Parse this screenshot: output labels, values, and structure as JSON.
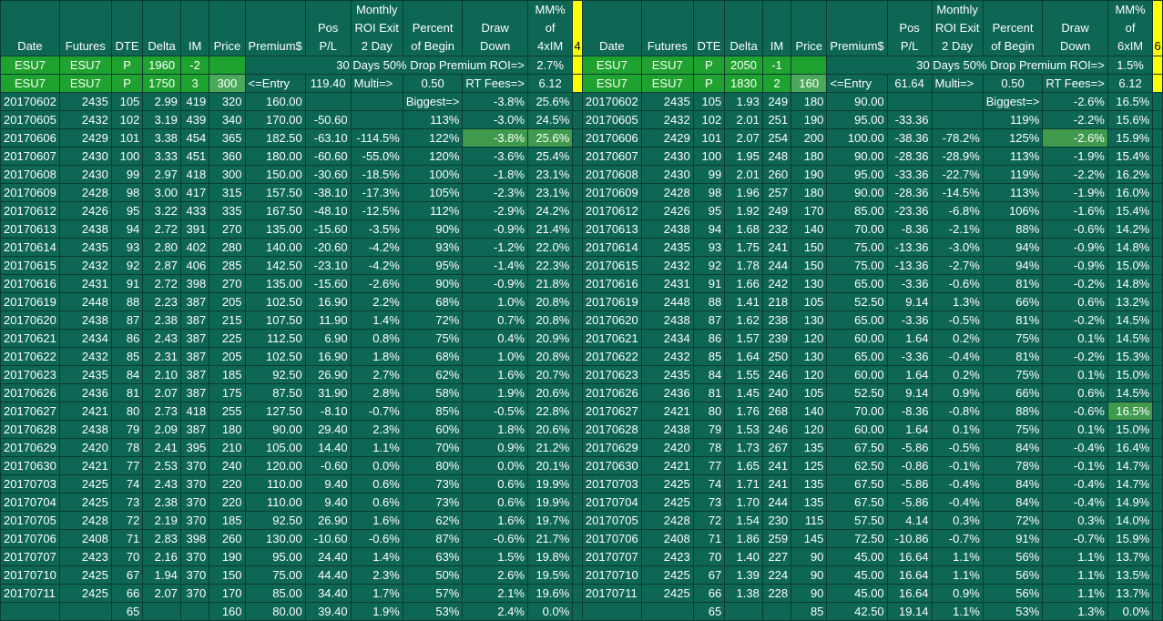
{
  "colors": {
    "background": "#0e6655",
    "header_green": "#1fa22f",
    "highlight_green": "#3f9a4e",
    "marker_yellow": "#ffff00"
  },
  "left": {
    "headers": [
      "Date",
      "Futures",
      "DTE",
      "Delta",
      "IM",
      "Price",
      "Premium$",
      "Pos P/L",
      "Monthly ROI Exit 2 Day",
      "Percent of Begin",
      "Draw Down",
      "MM% of 4xIM"
    ],
    "marker": "4",
    "setup1": {
      "date": "ESU7",
      "futures": "ESU7",
      "dte": "P",
      "delta": "1960",
      "im": "-2",
      "summary": "30 Days 50% Drop Premium ROI=>",
      "mm": "2.7%"
    },
    "setup2": {
      "date": "ESU7",
      "futures": "ESU7",
      "dte": "P",
      "delta": "1750",
      "im": "3",
      "price": "300",
      "premium": "<=Entry",
      "pospl": "119.40",
      "roi": "Multi=>",
      "pct": "0.50",
      "draw": "RT Fees=>",
      "mm": "6.12"
    },
    "rows": [
      [
        "20170602",
        "2435",
        "105",
        "2.99",
        "419",
        "320",
        "160.00",
        "",
        "",
        "Biggest=>",
        "-3.8%",
        "25.6%"
      ],
      [
        "20170605",
        "2432",
        "102",
        "3.19",
        "439",
        "340",
        "170.00",
        "-50.60",
        "",
        "113%",
        "-3.0%",
        "24.5%"
      ],
      [
        "20170606",
        "2429",
        "101",
        "3.38",
        "454",
        "365",
        "182.50",
        "-63.10",
        "-114.5%",
        "122%",
        "-3.8%",
        "25.6%"
      ],
      [
        "20170607",
        "2430",
        "100",
        "3.33",
        "451",
        "360",
        "180.00",
        "-60.60",
        "-55.0%",
        "120%",
        "-3.6%",
        "25.4%"
      ],
      [
        "20170608",
        "2430",
        "99",
        "2.97",
        "418",
        "300",
        "150.00",
        "-30.60",
        "-18.5%",
        "100%",
        "-1.8%",
        "23.1%"
      ],
      [
        "20170609",
        "2428",
        "98",
        "3.00",
        "417",
        "315",
        "157.50",
        "-38.10",
        "-17.3%",
        "105%",
        "-2.3%",
        "23.1%"
      ],
      [
        "20170612",
        "2426",
        "95",
        "3.22",
        "433",
        "335",
        "167.50",
        "-48.10",
        "-12.5%",
        "112%",
        "-2.9%",
        "24.2%"
      ],
      [
        "20170613",
        "2438",
        "94",
        "2.72",
        "391",
        "270",
        "135.00",
        "-15.60",
        "-3.5%",
        "90%",
        "-0.9%",
        "21.4%"
      ],
      [
        "20170614",
        "2435",
        "93",
        "2.80",
        "402",
        "280",
        "140.00",
        "-20.60",
        "-4.2%",
        "93%",
        "-1.2%",
        "22.0%"
      ],
      [
        "20170615",
        "2432",
        "92",
        "2.87",
        "406",
        "285",
        "142.50",
        "-23.10",
        "-4.2%",
        "95%",
        "-1.4%",
        "22.3%"
      ],
      [
        "20170616",
        "2431",
        "91",
        "2.72",
        "398",
        "270",
        "135.00",
        "-15.60",
        "-2.6%",
        "90%",
        "-0.9%",
        "21.8%"
      ],
      [
        "20170619",
        "2448",
        "88",
        "2.23",
        "387",
        "205",
        "102.50",
        "16.90",
        "2.2%",
        "68%",
        "1.0%",
        "20.8%"
      ],
      [
        "20170620",
        "2438",
        "87",
        "2.38",
        "387",
        "215",
        "107.50",
        "11.90",
        "1.4%",
        "72%",
        "0.7%",
        "20.8%"
      ],
      [
        "20170621",
        "2434",
        "86",
        "2.43",
        "387",
        "225",
        "112.50",
        "6.90",
        "0.8%",
        "75%",
        "0.4%",
        "20.9%"
      ],
      [
        "20170622",
        "2432",
        "85",
        "2.31",
        "387",
        "205",
        "102.50",
        "16.90",
        "1.8%",
        "68%",
        "1.0%",
        "20.8%"
      ],
      [
        "20170623",
        "2435",
        "84",
        "2.10",
        "387",
        "185",
        "92.50",
        "26.90",
        "2.7%",
        "62%",
        "1.6%",
        "20.7%"
      ],
      [
        "20170626",
        "2436",
        "81",
        "2.07",
        "387",
        "175",
        "87.50",
        "31.90",
        "2.8%",
        "58%",
        "1.9%",
        "20.6%"
      ],
      [
        "20170627",
        "2421",
        "80",
        "2.73",
        "418",
        "255",
        "127.50",
        "-8.10",
        "-0.7%",
        "85%",
        "-0.5%",
        "22.8%"
      ],
      [
        "20170628",
        "2438",
        "79",
        "2.09",
        "387",
        "180",
        "90.00",
        "29.40",
        "2.3%",
        "60%",
        "1.8%",
        "20.6%"
      ],
      [
        "20170629",
        "2420",
        "78",
        "2.41",
        "395",
        "210",
        "105.00",
        "14.40",
        "1.1%",
        "70%",
        "0.9%",
        "21.2%"
      ],
      [
        "20170630",
        "2421",
        "77",
        "2.53",
        "370",
        "240",
        "120.00",
        "-0.60",
        "0.0%",
        "80%",
        "0.0%",
        "20.1%"
      ],
      [
        "20170703",
        "2425",
        "74",
        "2.43",
        "370",
        "220",
        "110.00",
        "9.40",
        "0.6%",
        "73%",
        "0.6%",
        "19.9%"
      ],
      [
        "20170704",
        "2425",
        "73",
        "2.38",
        "370",
        "220",
        "110.00",
        "9.40",
        "0.6%",
        "73%",
        "0.6%",
        "19.9%"
      ],
      [
        "20170705",
        "2428",
        "72",
        "2.19",
        "370",
        "185",
        "92.50",
        "26.90",
        "1.6%",
        "62%",
        "1.6%",
        "19.7%"
      ],
      [
        "20170706",
        "2408",
        "71",
        "2.83",
        "398",
        "260",
        "130.00",
        "-10.60",
        "-0.6%",
        "87%",
        "-0.6%",
        "21.7%"
      ],
      [
        "20170707",
        "2423",
        "70",
        "2.16",
        "370",
        "190",
        "95.00",
        "24.40",
        "1.4%",
        "63%",
        "1.5%",
        "19.8%"
      ],
      [
        "20170710",
        "2425",
        "67",
        "1.94",
        "370",
        "150",
        "75.00",
        "44.40",
        "2.3%",
        "50%",
        "2.6%",
        "19.5%"
      ],
      [
        "20170711",
        "2425",
        "66",
        "2.07",
        "370",
        "170",
        "85.00",
        "34.40",
        "1.7%",
        "57%",
        "2.1%",
        "19.6%"
      ]
    ],
    "totals": [
      "",
      "",
      "65",
      "",
      "",
      "160",
      "80.00",
      "39.40",
      "1.9%",
      "53%",
      "2.4%",
      "0.0%"
    ]
  },
  "right": {
    "headers": [
      "Date",
      "Futures",
      "DTE",
      "Delta",
      "IM",
      "Price",
      "Premium$",
      "Pos P/L",
      "Monthly ROI Exit 2 Day",
      "Percent of Begin",
      "Draw Down",
      "MM% of 6xIM"
    ],
    "marker": "6",
    "setup1": {
      "date": "ESU7",
      "futures": "ESU7",
      "dte": "P",
      "delta": "2050",
      "im": "-1",
      "summary": "30 Days 50% Drop Premium ROI=>",
      "mm": "1.5%"
    },
    "setup2": {
      "date": "ESU7",
      "futures": "ESU7",
      "dte": "P",
      "delta": "1830",
      "im": "2",
      "price": "160",
      "premium": "<=Entry",
      "pospl": "61.64",
      "roi": "Multi=>",
      "pct": "0.50",
      "draw": "RT Fees=>",
      "mm": "6.12"
    },
    "rows": [
      [
        "20170602",
        "2435",
        "105",
        "1.93",
        "249",
        "180",
        "90.00",
        "",
        "",
        "Biggest=>",
        "-2.6%",
        "16.5%"
      ],
      [
        "20170605",
        "2432",
        "102",
        "2.01",
        "251",
        "190",
        "95.00",
        "-33.36",
        "",
        "119%",
        "-2.2%",
        "15.6%"
      ],
      [
        "20170606",
        "2429",
        "101",
        "2.07",
        "254",
        "200",
        "100.00",
        "-38.36",
        "-78.2%",
        "125%",
        "-2.6%",
        "15.9%"
      ],
      [
        "20170607",
        "2430",
        "100",
        "1.95",
        "248",
        "180",
        "90.00",
        "-28.36",
        "-28.9%",
        "113%",
        "-1.9%",
        "15.4%"
      ],
      [
        "20170608",
        "2430",
        "99",
        "2.01",
        "260",
        "190",
        "95.00",
        "-33.36",
        "-22.7%",
        "119%",
        "-2.2%",
        "16.2%"
      ],
      [
        "20170609",
        "2428",
        "98",
        "1.96",
        "257",
        "180",
        "90.00",
        "-28.36",
        "-14.5%",
        "113%",
        "-1.9%",
        "16.0%"
      ],
      [
        "20170612",
        "2426",
        "95",
        "1.92",
        "249",
        "170",
        "85.00",
        "-23.36",
        "-6.8%",
        "106%",
        "-1.6%",
        "15.4%"
      ],
      [
        "20170613",
        "2438",
        "94",
        "1.68",
        "232",
        "140",
        "70.00",
        "-8.36",
        "-2.1%",
        "88%",
        "-0.6%",
        "14.2%"
      ],
      [
        "20170614",
        "2435",
        "93",
        "1.75",
        "241",
        "150",
        "75.00",
        "-13.36",
        "-3.0%",
        "94%",
        "-0.9%",
        "14.8%"
      ],
      [
        "20170615",
        "2432",
        "92",
        "1.78",
        "244",
        "150",
        "75.00",
        "-13.36",
        "-2.7%",
        "94%",
        "-0.9%",
        "15.0%"
      ],
      [
        "20170616",
        "2431",
        "91",
        "1.66",
        "242",
        "130",
        "65.00",
        "-3.36",
        "-0.6%",
        "81%",
        "-0.2%",
        "14.8%"
      ],
      [
        "20170619",
        "2448",
        "88",
        "1.41",
        "218",
        "105",
        "52.50",
        "9.14",
        "1.3%",
        "66%",
        "0.6%",
        "13.2%"
      ],
      [
        "20170620",
        "2438",
        "87",
        "1.62",
        "238",
        "130",
        "65.00",
        "-3.36",
        "-0.5%",
        "81%",
        "-0.2%",
        "14.5%"
      ],
      [
        "20170621",
        "2434",
        "86",
        "1.57",
        "239",
        "120",
        "60.00",
        "1.64",
        "0.2%",
        "75%",
        "0.1%",
        "14.5%"
      ],
      [
        "20170622",
        "2432",
        "85",
        "1.64",
        "250",
        "130",
        "65.00",
        "-3.36",
        "-0.4%",
        "81%",
        "-0.2%",
        "15.3%"
      ],
      [
        "20170623",
        "2435",
        "84",
        "1.55",
        "246",
        "120",
        "60.00",
        "1.64",
        "0.2%",
        "75%",
        "0.1%",
        "15.0%"
      ],
      [
        "20170626",
        "2436",
        "81",
        "1.45",
        "240",
        "105",
        "52.50",
        "9.14",
        "0.9%",
        "66%",
        "0.6%",
        "14.5%"
      ],
      [
        "20170627",
        "2421",
        "80",
        "1.76",
        "268",
        "140",
        "70.00",
        "-8.36",
        "-0.8%",
        "88%",
        "-0.6%",
        "16.5%"
      ],
      [
        "20170628",
        "2438",
        "79",
        "1.53",
        "246",
        "120",
        "60.00",
        "1.64",
        "0.1%",
        "75%",
        "0.1%",
        "15.0%"
      ],
      [
        "20170629",
        "2420",
        "78",
        "1.73",
        "267",
        "135",
        "67.50",
        "-5.86",
        "-0.5%",
        "84%",
        "-0.4%",
        "16.4%"
      ],
      [
        "20170630",
        "2421",
        "77",
        "1.65",
        "241",
        "125",
        "62.50",
        "-0.86",
        "-0.1%",
        "78%",
        "-0.1%",
        "14.7%"
      ],
      [
        "20170703",
        "2425",
        "74",
        "1.71",
        "241",
        "135",
        "67.50",
        "-5.86",
        "-0.4%",
        "84%",
        "-0.4%",
        "14.7%"
      ],
      [
        "20170704",
        "2425",
        "73",
        "1.70",
        "244",
        "135",
        "67.50",
        "-5.86",
        "-0.4%",
        "84%",
        "-0.4%",
        "14.9%"
      ],
      [
        "20170705",
        "2428",
        "72",
        "1.54",
        "230",
        "115",
        "57.50",
        "4.14",
        "0.3%",
        "72%",
        "0.3%",
        "14.0%"
      ],
      [
        "20170706",
        "2408",
        "71",
        "1.86",
        "259",
        "145",
        "72.50",
        "-10.86",
        "-0.7%",
        "91%",
        "-0.7%",
        "15.9%"
      ],
      [
        "20170707",
        "2423",
        "70",
        "1.40",
        "227",
        "90",
        "45.00",
        "16.64",
        "1.1%",
        "56%",
        "1.1%",
        "13.7%"
      ],
      [
        "20170710",
        "2425",
        "67",
        "1.39",
        "224",
        "90",
        "45.00",
        "16.64",
        "1.1%",
        "56%",
        "1.1%",
        "13.5%"
      ],
      [
        "20170711",
        "2425",
        "66",
        "1.38",
        "228",
        "90",
        "45.00",
        "16.64",
        "0.9%",
        "56%",
        "1.1%",
        "13.7%"
      ]
    ],
    "totals": [
      "",
      "",
      "65",
      "",
      "",
      "85",
      "42.50",
      "19.14",
      "1.1%",
      "53%",
      "1.3%",
      "0.0%"
    ]
  }
}
